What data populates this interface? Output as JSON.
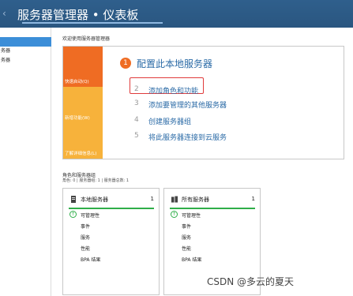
{
  "header": {
    "title": "服务器管理器 • 仪表板"
  },
  "sidebar": {
    "items": [
      {
        "label": "",
        "selected": true
      },
      {
        "label": "务器",
        "selected": false
      },
      {
        "label": "务器",
        "selected": false
      }
    ]
  },
  "welcome": {
    "text": "欢迎使用服务器管理器"
  },
  "quick_start": {
    "tiles": [
      {
        "label": "快速启动(Q)"
      },
      {
        "label": "新增功能(W)"
      },
      {
        "label": "了解详细信息(L)"
      }
    ],
    "main_step": {
      "number": "1",
      "label": "配置此本地服务器"
    },
    "steps": [
      {
        "number": "2",
        "label": "添加角色和功能",
        "highlighted": true
      },
      {
        "number": "3",
        "label": "添加要管理的其他服务器"
      },
      {
        "number": "4",
        "label": "创建服务器组"
      },
      {
        "number": "5",
        "label": "将此服务器连接到云服务"
      }
    ]
  },
  "roles": {
    "title": "角色和服务器组",
    "subtitle": "角色: 0 | 服务器组: 1 | 服务器总数: 1",
    "cards": [
      {
        "title": "本地服务器",
        "count": "1",
        "rows": [
          "可管理性",
          "事件",
          "服务",
          "性能",
          "BPA 结果"
        ]
      },
      {
        "title": "所有服务器",
        "count": "1",
        "rows": [
          "可管理性",
          "事件",
          "服务",
          "性能",
          "BPA 结果"
        ]
      }
    ]
  },
  "watermark": "CSDN @多云的夏天",
  "colors": {
    "header": "#2f5f8c",
    "accent_orange": "#ef6c23",
    "tile_yellow": "#f7b23b",
    "link_blue": "#2a6aa6",
    "status_green": "#2fae49",
    "selected_blue": "#3c8ed8",
    "highlight_red": "#e03b3b"
  }
}
